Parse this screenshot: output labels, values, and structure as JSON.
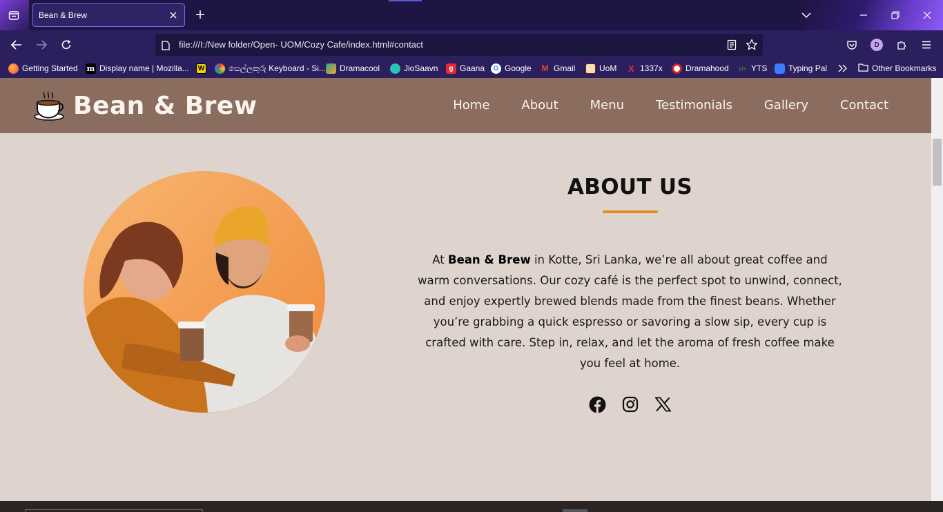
{
  "browser": {
    "tab": {
      "title": "Bean & Brew"
    },
    "address_bar": {
      "url": "file:///I:/New folder/Open- UOM/Cozy Cafe/index.html#contact"
    },
    "profile_initial": "D",
    "bookmarks": [
      {
        "label": "Getting Started",
        "icon": "firefox-icon",
        "color": "#ff7139"
      },
      {
        "label": "Display name | Mozilla...",
        "icon": "medium-icon",
        "color": "#000000"
      },
      {
        "label": "",
        "icon": "w-icon",
        "color": "#f5d300"
      },
      {
        "label": "සෙල්ලකුරු Keyboard - Si...",
        "icon": "flower-icon",
        "color": "#e53935"
      },
      {
        "label": "Dramacool",
        "icon": "dramacool-icon",
        "color": "#2aa198"
      },
      {
        "label": "JioSaavn",
        "icon": "jiosaavn-icon",
        "color": "#2bc5b4"
      },
      {
        "label": "Gaana",
        "icon": "gaana-icon",
        "color": "#e72c30"
      },
      {
        "label": "Google",
        "icon": "google-icon",
        "color": "#4285f4"
      },
      {
        "label": "Gmail",
        "icon": "gmail-icon",
        "color": "#ea4335"
      },
      {
        "label": "UoM",
        "icon": "uom-icon",
        "color": "#7a1e1e"
      },
      {
        "label": "1337x",
        "icon": "x-icon",
        "color": "#e0322b"
      },
      {
        "label": "Dramahood",
        "icon": "dramahood-icon",
        "color": "#c62828"
      },
      {
        "label": "YTS",
        "icon": "yts-icon",
        "color": "#2e7d32"
      },
      {
        "label": "Typing Pal",
        "icon": "typingpal-icon",
        "color": "#3d7bff"
      },
      {
        "label": "Other Bookmarks",
        "icon": "folder-icon",
        "color": "#ffffff"
      }
    ]
  },
  "site": {
    "brand": "Bean & Brew",
    "nav": [
      "Home",
      "About",
      "Menu",
      "Testimonials",
      "Gallery",
      "Contact"
    ],
    "about": {
      "heading": "ABOUT US",
      "text_before": "At ",
      "brand_bold": "Bean & Brew",
      "text_after": " in Kotte, Sri Lanka, we’re all about great coffee and warm conversations. Our cozy café is the perfect spot to unwind, connect, and enjoy expertly brewed blends made from the finest beans. Whether you’re grabbing a quick espresso or savoring a slow sip, every cup is crafted with care. Step in, relax, and let the aroma of fresh coffee make you feel at home."
    },
    "social": [
      "facebook-icon",
      "instagram-icon",
      "x-icon"
    ],
    "colors": {
      "header_bg": "#8a6d5f",
      "page_bg": "#dfd3ce",
      "accent": "#e08b1c"
    }
  }
}
